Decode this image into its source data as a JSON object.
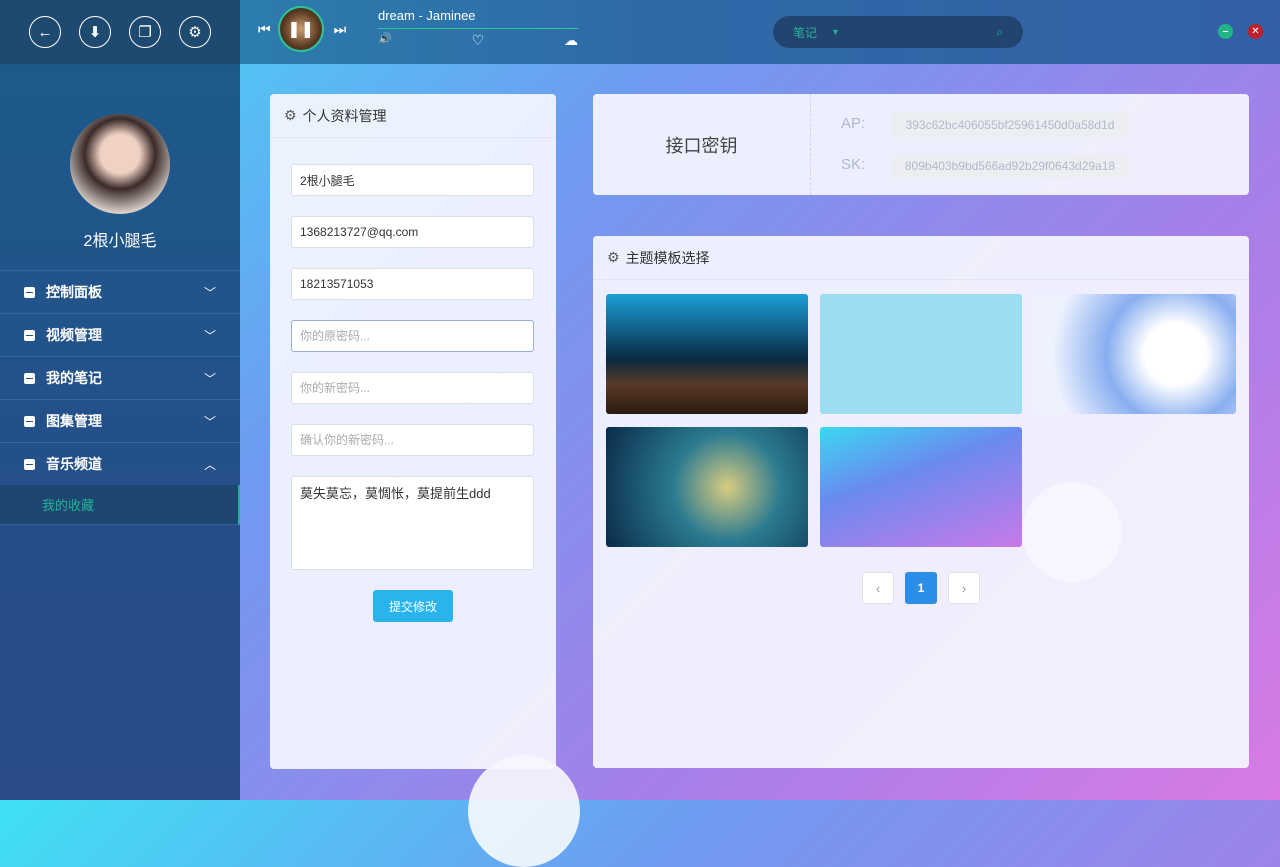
{
  "toolbar": {
    "icons": [
      "back-icon",
      "download-icon",
      "chat-icon",
      "gear-icon"
    ]
  },
  "player": {
    "track": "dream - Jaminee",
    "prev": "⏮",
    "pause": "❚❚",
    "next": "⏭",
    "volume": "🔊",
    "like": "♡",
    "cloud": "☁"
  },
  "search": {
    "category": "笔记",
    "placeholder": ""
  },
  "sidebar": {
    "username": "2根小腿毛",
    "items": [
      {
        "label": "控制面板"
      },
      {
        "label": "视频管理"
      },
      {
        "label": "我的笔记"
      },
      {
        "label": "图集管理"
      },
      {
        "label": "音乐频道",
        "expanded": true
      }
    ],
    "sub_item": "我的收藏"
  },
  "profile": {
    "title": "个人资料管理",
    "nickname": "2根小腿毛",
    "email": "1368213727@qq.com",
    "phone": "18213571053",
    "old_pw_ph": "你的原密码...",
    "new_pw_ph": "你的新密码...",
    "confirm_ph": "确认你的新密码...",
    "bio": "莫失莫忘，莫惆怅，莫提前生ddd",
    "submit": "提交修改"
  },
  "keys": {
    "title": "接口密钥",
    "ap_label": "AP:",
    "ap": "393c62bc406055bf25961450d0a58d1d",
    "sk_label": "SK:",
    "sk": "809b403b9bd566ad92b29f0643d29a18"
  },
  "themes": {
    "title": "主题模板选择",
    "pagination": {
      "current": "1",
      "prev": "‹",
      "next": "›"
    }
  },
  "colors": {
    "accent": "#22b396",
    "primary": "#2ab4ee"
  }
}
